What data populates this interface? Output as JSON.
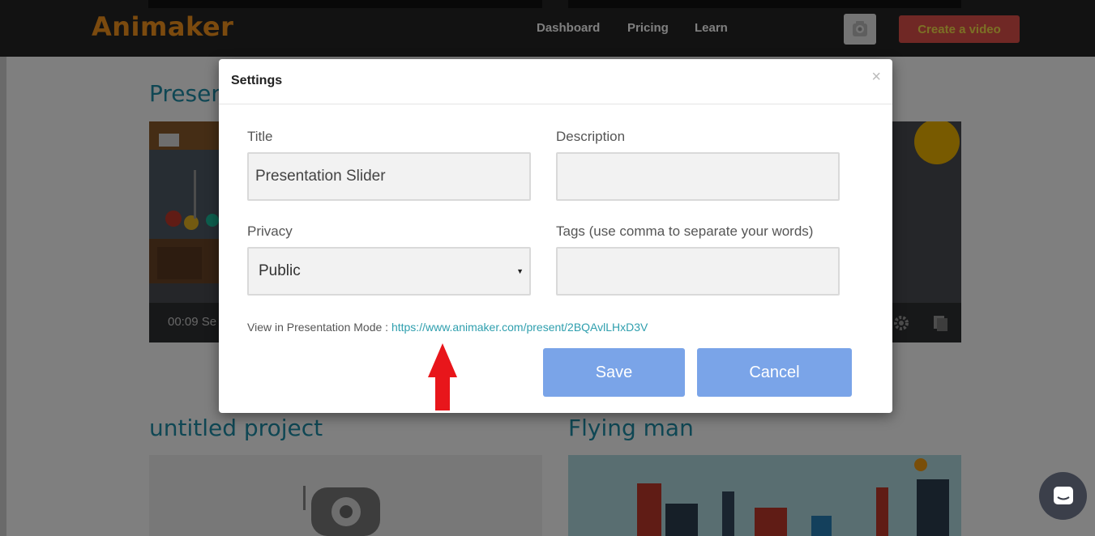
{
  "header": {
    "logo": "Animaker",
    "nav": [
      "Dashboard",
      "Pricing",
      "Learn"
    ],
    "create_button": "Create a video"
  },
  "projects": [
    {
      "title": "Presentation Slider",
      "duration": "00:09 Se"
    },
    {
      "title": "untitled project"
    },
    {
      "title": "Flying man"
    }
  ],
  "modal": {
    "title": "Settings",
    "close": "×",
    "title_label": "Title",
    "title_value": "Presentation Slider",
    "description_label": "Description",
    "description_value": "",
    "privacy_label": "Privacy",
    "privacy_value": "Public",
    "tags_label": "Tags (use comma to separate your words)",
    "tags_value": "",
    "presentation_label": "View in Presentation Mode : ",
    "presentation_url": "https://www.animaker.com/present/2BQAvlLHxD3V",
    "save": "Save",
    "cancel": "Cancel"
  },
  "colors": {
    "topbar": "#252525",
    "logo": "#f7941d",
    "create_button_bg": "#e0514a",
    "create_button_text": "#f9e04b",
    "project_title": "#1e8ea8",
    "modal_button": "#7aa4e8",
    "link": "#2f9fae",
    "arrow": "#e8161b"
  },
  "icons": {
    "avatar": "user-avatar-icon",
    "close": "close-icon",
    "caret": "caret-down-icon",
    "arrow": "red-arrow-up-icon",
    "chat": "chat-icon",
    "settings": "gear-icon",
    "copy": "copy-icon"
  }
}
